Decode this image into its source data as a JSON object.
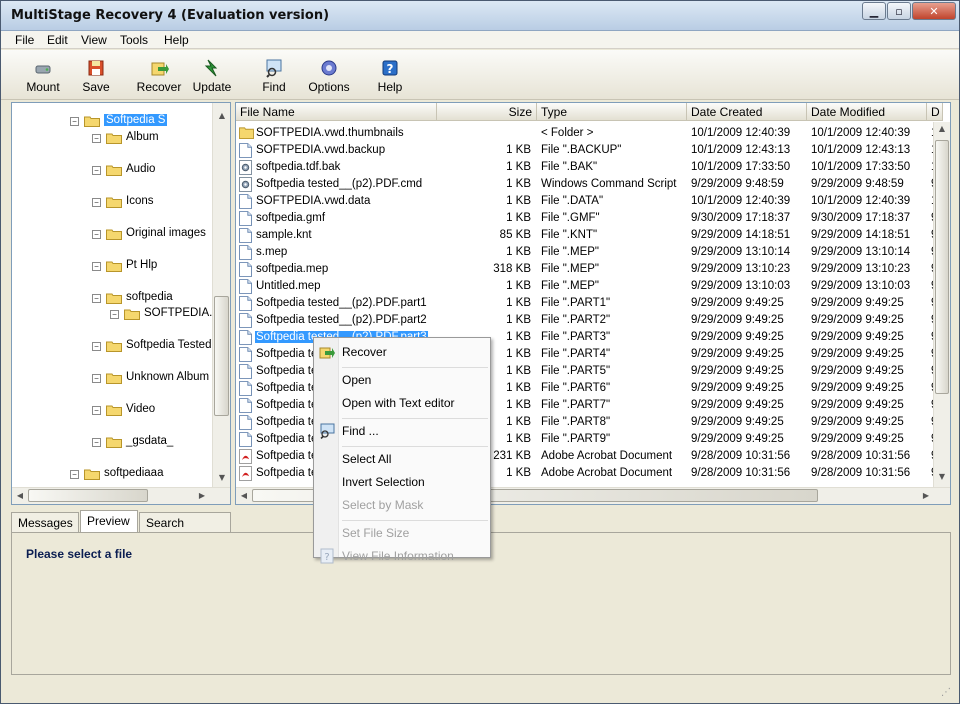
{
  "window": {
    "title": "MultiStage Recovery 4 (Evaluation version)"
  },
  "menu": [
    "File",
    "Edit",
    "View",
    "Tools",
    "Help"
  ],
  "toolbar": [
    {
      "label": "Mount",
      "icon": "mount-icon"
    },
    {
      "label": "Save",
      "icon": "save-icon"
    },
    {
      "label": "Recover",
      "icon": "recover-icon"
    },
    {
      "label": "Update",
      "icon": "update-icon"
    },
    {
      "label": "Find",
      "icon": "find-icon"
    },
    {
      "label": "Options",
      "icon": "options-icon"
    },
    {
      "label": "Help",
      "icon": "help-icon"
    }
  ],
  "tree": [
    {
      "label": "Softpedia S",
      "level": 0,
      "selected": true
    },
    {
      "label": "Album",
      "level": 1
    },
    {
      "label": "Audio",
      "level": 1
    },
    {
      "label": "Icons",
      "level": 1
    },
    {
      "label": "Original images",
      "level": 1
    },
    {
      "label": "Pt Hlp",
      "level": 1
    },
    {
      "label": "softpedia",
      "level": 1
    },
    {
      "label": "SOFTPEDIA.v",
      "level": 2
    },
    {
      "label": "Softpedia Tested",
      "level": 1
    },
    {
      "label": "Unknown Album",
      "level": 1
    },
    {
      "label": "Video",
      "level": 1
    },
    {
      "label": "_gsdata_",
      "level": 1
    },
    {
      "label": "softpediaaa",
      "level": 0
    }
  ],
  "columns": [
    "File Name",
    "Size",
    "Type",
    "Date Created",
    "Date Modified",
    "D"
  ],
  "files": [
    {
      "name": "SOFTPEDIA.vwd.thumbnails",
      "size": "",
      "type": "< Folder >",
      "created": "10/1/2009 12:40:39",
      "modified": "10/1/2009 12:40:39",
      "extra": "1",
      "icon": "folder"
    },
    {
      "name": "SOFTPEDIA.vwd.backup",
      "size": "1 KB",
      "type": "File \".BACKUP\"",
      "created": "10/1/2009 12:43:13",
      "modified": "10/1/2009 12:43:13",
      "extra": "1",
      "icon": "doc"
    },
    {
      "name": "softpedia.tdf.bak",
      "size": "1 KB",
      "type": "File \".BAK\"",
      "created": "10/1/2009 17:33:50",
      "modified": "10/1/2009 17:33:50",
      "extra": "1",
      "icon": "gear"
    },
    {
      "name": "Softpedia tested__(p2).PDF.cmd",
      "size": "1 KB",
      "type": "Windows Command Script",
      "created": "9/29/2009 9:48:59",
      "modified": "9/29/2009 9:48:59",
      "extra": "9",
      "icon": "gear"
    },
    {
      "name": "SOFTPEDIA.vwd.data",
      "size": "1 KB",
      "type": "File \".DATA\"",
      "created": "10/1/2009 12:40:39",
      "modified": "10/1/2009 12:40:39",
      "extra": "1",
      "icon": "doc"
    },
    {
      "name": "softpedia.gmf",
      "size": "1 KB",
      "type": "File \".GMF\"",
      "created": "9/30/2009 17:18:37",
      "modified": "9/30/2009 17:18:37",
      "extra": "9",
      "icon": "doc"
    },
    {
      "name": "sample.knt",
      "size": "85 KB",
      "type": "File \".KNT\"",
      "created": "9/29/2009 14:18:51",
      "modified": "9/29/2009 14:18:51",
      "extra": "9",
      "icon": "doc"
    },
    {
      "name": "s.mep",
      "size": "1 KB",
      "type": "File \".MEP\"",
      "created": "9/29/2009 13:10:14",
      "modified": "9/29/2009 13:10:14",
      "extra": "9",
      "icon": "doc"
    },
    {
      "name": "softpedia.mep",
      "size": "318 KB",
      "type": "File \".MEP\"",
      "created": "9/29/2009 13:10:23",
      "modified": "9/29/2009 13:10:23",
      "extra": "9",
      "icon": "doc"
    },
    {
      "name": "Untitled.mep",
      "size": "1 KB",
      "type": "File \".MEP\"",
      "created": "9/29/2009 13:10:03",
      "modified": "9/29/2009 13:10:03",
      "extra": "9",
      "icon": "doc"
    },
    {
      "name": "Softpedia tested__(p2).PDF.part1",
      "size": "1 KB",
      "type": "File \".PART1\"",
      "created": "9/29/2009 9:49:25",
      "modified": "9/29/2009 9:49:25",
      "extra": "9",
      "icon": "doc"
    },
    {
      "name": "Softpedia tested__(p2).PDF.part2",
      "size": "1 KB",
      "type": "File \".PART2\"",
      "created": "9/29/2009 9:49:25",
      "modified": "9/29/2009 9:49:25",
      "extra": "9",
      "icon": "doc"
    },
    {
      "name": "Softpedia tested__(p2).PDF.part3",
      "size": "1 KB",
      "type": "File \".PART3\"",
      "created": "9/29/2009 9:49:25",
      "modified": "9/29/2009 9:49:25",
      "extra": "9",
      "icon": "doc",
      "selected": true
    },
    {
      "name": "Softpedia te",
      "size": "1 KB",
      "type": "File \".PART4\"",
      "created": "9/29/2009 9:49:25",
      "modified": "9/29/2009 9:49:25",
      "extra": "9",
      "icon": "doc"
    },
    {
      "name": "Softpedia te",
      "size": "1 KB",
      "type": "File \".PART5\"",
      "created": "9/29/2009 9:49:25",
      "modified": "9/29/2009 9:49:25",
      "extra": "9",
      "icon": "doc"
    },
    {
      "name": "Softpedia te",
      "size": "1 KB",
      "type": "File \".PART6\"",
      "created": "9/29/2009 9:49:25",
      "modified": "9/29/2009 9:49:25",
      "extra": "9",
      "icon": "doc"
    },
    {
      "name": "Softpedia te",
      "size": "1 KB",
      "type": "File \".PART7\"",
      "created": "9/29/2009 9:49:25",
      "modified": "9/29/2009 9:49:25",
      "extra": "9",
      "icon": "doc"
    },
    {
      "name": "Softpedia te",
      "size": "1 KB",
      "type": "File \".PART8\"",
      "created": "9/29/2009 9:49:25",
      "modified": "9/29/2009 9:49:25",
      "extra": "9",
      "icon": "doc"
    },
    {
      "name": "Softpedia te",
      "size": "1 KB",
      "type": "File \".PART9\"",
      "created": "9/29/2009 9:49:25",
      "modified": "9/29/2009 9:49:25",
      "extra": "9",
      "icon": "doc"
    },
    {
      "name": "Softpedia te",
      "size": "231 KB",
      "type": "Adobe Acrobat Document",
      "created": "9/28/2009 10:31:56",
      "modified": "9/28/2009 10:31:56",
      "extra": "9",
      "icon": "pdf"
    },
    {
      "name": "Softpedia te",
      "size": "1 KB",
      "type": "Adobe Acrobat Document",
      "created": "9/28/2009 10:31:56",
      "modified": "9/28/2009 10:31:56",
      "extra": "9",
      "icon": "pdf"
    }
  ],
  "tabs": [
    "Messages",
    "Preview",
    "Search Results"
  ],
  "active_tab": 1,
  "preview": {
    "message": "Please select a file"
  },
  "context_menu": [
    {
      "label": "Recover",
      "icon": "recover-icon",
      "enabled": true
    },
    {
      "sep": true
    },
    {
      "label": "Open",
      "enabled": true
    },
    {
      "label": "Open with Text editor",
      "enabled": true
    },
    {
      "sep": true
    },
    {
      "label": "Find ...",
      "icon": "find-icon",
      "enabled": true
    },
    {
      "sep": true
    },
    {
      "label": "Select All",
      "enabled": true
    },
    {
      "label": "Invert Selection",
      "enabled": true
    },
    {
      "label": "Select by Mask",
      "enabled": false
    },
    {
      "sep": true
    },
    {
      "label": "Set File Size",
      "enabled": false
    },
    {
      "label": "View File Information",
      "icon": "info-icon",
      "enabled": false
    }
  ],
  "colors": {
    "selection": "#3399ff",
    "folder": "#f5d76e"
  }
}
